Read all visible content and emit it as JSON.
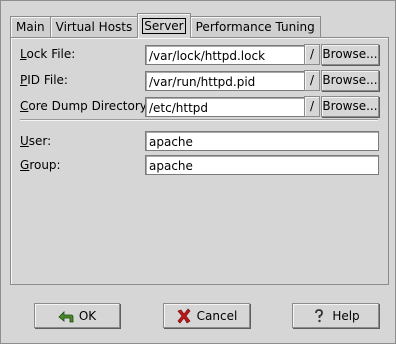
{
  "tabs": [
    {
      "label": "Main"
    },
    {
      "label": "Virtual Hosts"
    },
    {
      "label": "Server"
    },
    {
      "label": "Performance Tuning"
    }
  ],
  "fields": {
    "lock_file": {
      "label_ul": "L",
      "label_rest": "ock File:",
      "value": "/var/lock/httpd.lock"
    },
    "pid_file": {
      "label_ul": "P",
      "label_rest": "ID File:",
      "value": "/var/run/httpd.pid"
    },
    "core_dump": {
      "label_ul": "C",
      "label_rest": "ore Dump Directory:",
      "value": "/etc/httpd"
    },
    "user": {
      "label_ul": "U",
      "label_rest": "ser:",
      "value": "apache"
    },
    "group": {
      "label_ul": "G",
      "label_rest": "roup:",
      "value": "apache"
    }
  },
  "slash_label": "/",
  "browse_label": "Browse...",
  "buttons": {
    "ok": "OK",
    "cancel": "Cancel",
    "help": "Help"
  },
  "icons": {
    "ok": "arrow-left-icon",
    "cancel": "x-icon",
    "help": "question-icon"
  },
  "colors": {
    "background": "#d6d6d6",
    "ok_icon": "#4a8a2a",
    "cancel_icon": "#c01818"
  }
}
